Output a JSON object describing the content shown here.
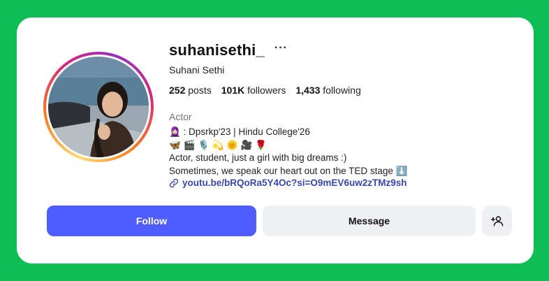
{
  "profile": {
    "username": "suhanisethi_",
    "more_label": "···",
    "full_name": "Suhani Sethi",
    "stats": {
      "posts_count": "252",
      "posts_label": "posts",
      "followers_count": "101K",
      "followers_label": "followers",
      "following_count": "1,433",
      "following_label": "following"
    },
    "category": "Actor",
    "bio_lines": [
      "🧕🏻 : Dpsrkp'23 | Hindu College'26",
      "🦋 🎬 🎙️ 💫 🌞 🎥 🌹",
      "Actor, student, just a girl with big dreams :)",
      "Sometimes, we speak our heart out on the TED stage ⬇️"
    ],
    "link": "youtu.be/bRQoRa5Y4Oc?si=O9mEV6uw2zTMz9sh"
  },
  "actions": {
    "follow_label": "Follow",
    "message_label": "Message",
    "add_user_icon": "person-plus-icon"
  },
  "colors": {
    "page_background": "#0fbd55",
    "follow_button": "#4f5cff",
    "secondary_button": "#eff0f3",
    "link": "#3847a8"
  }
}
